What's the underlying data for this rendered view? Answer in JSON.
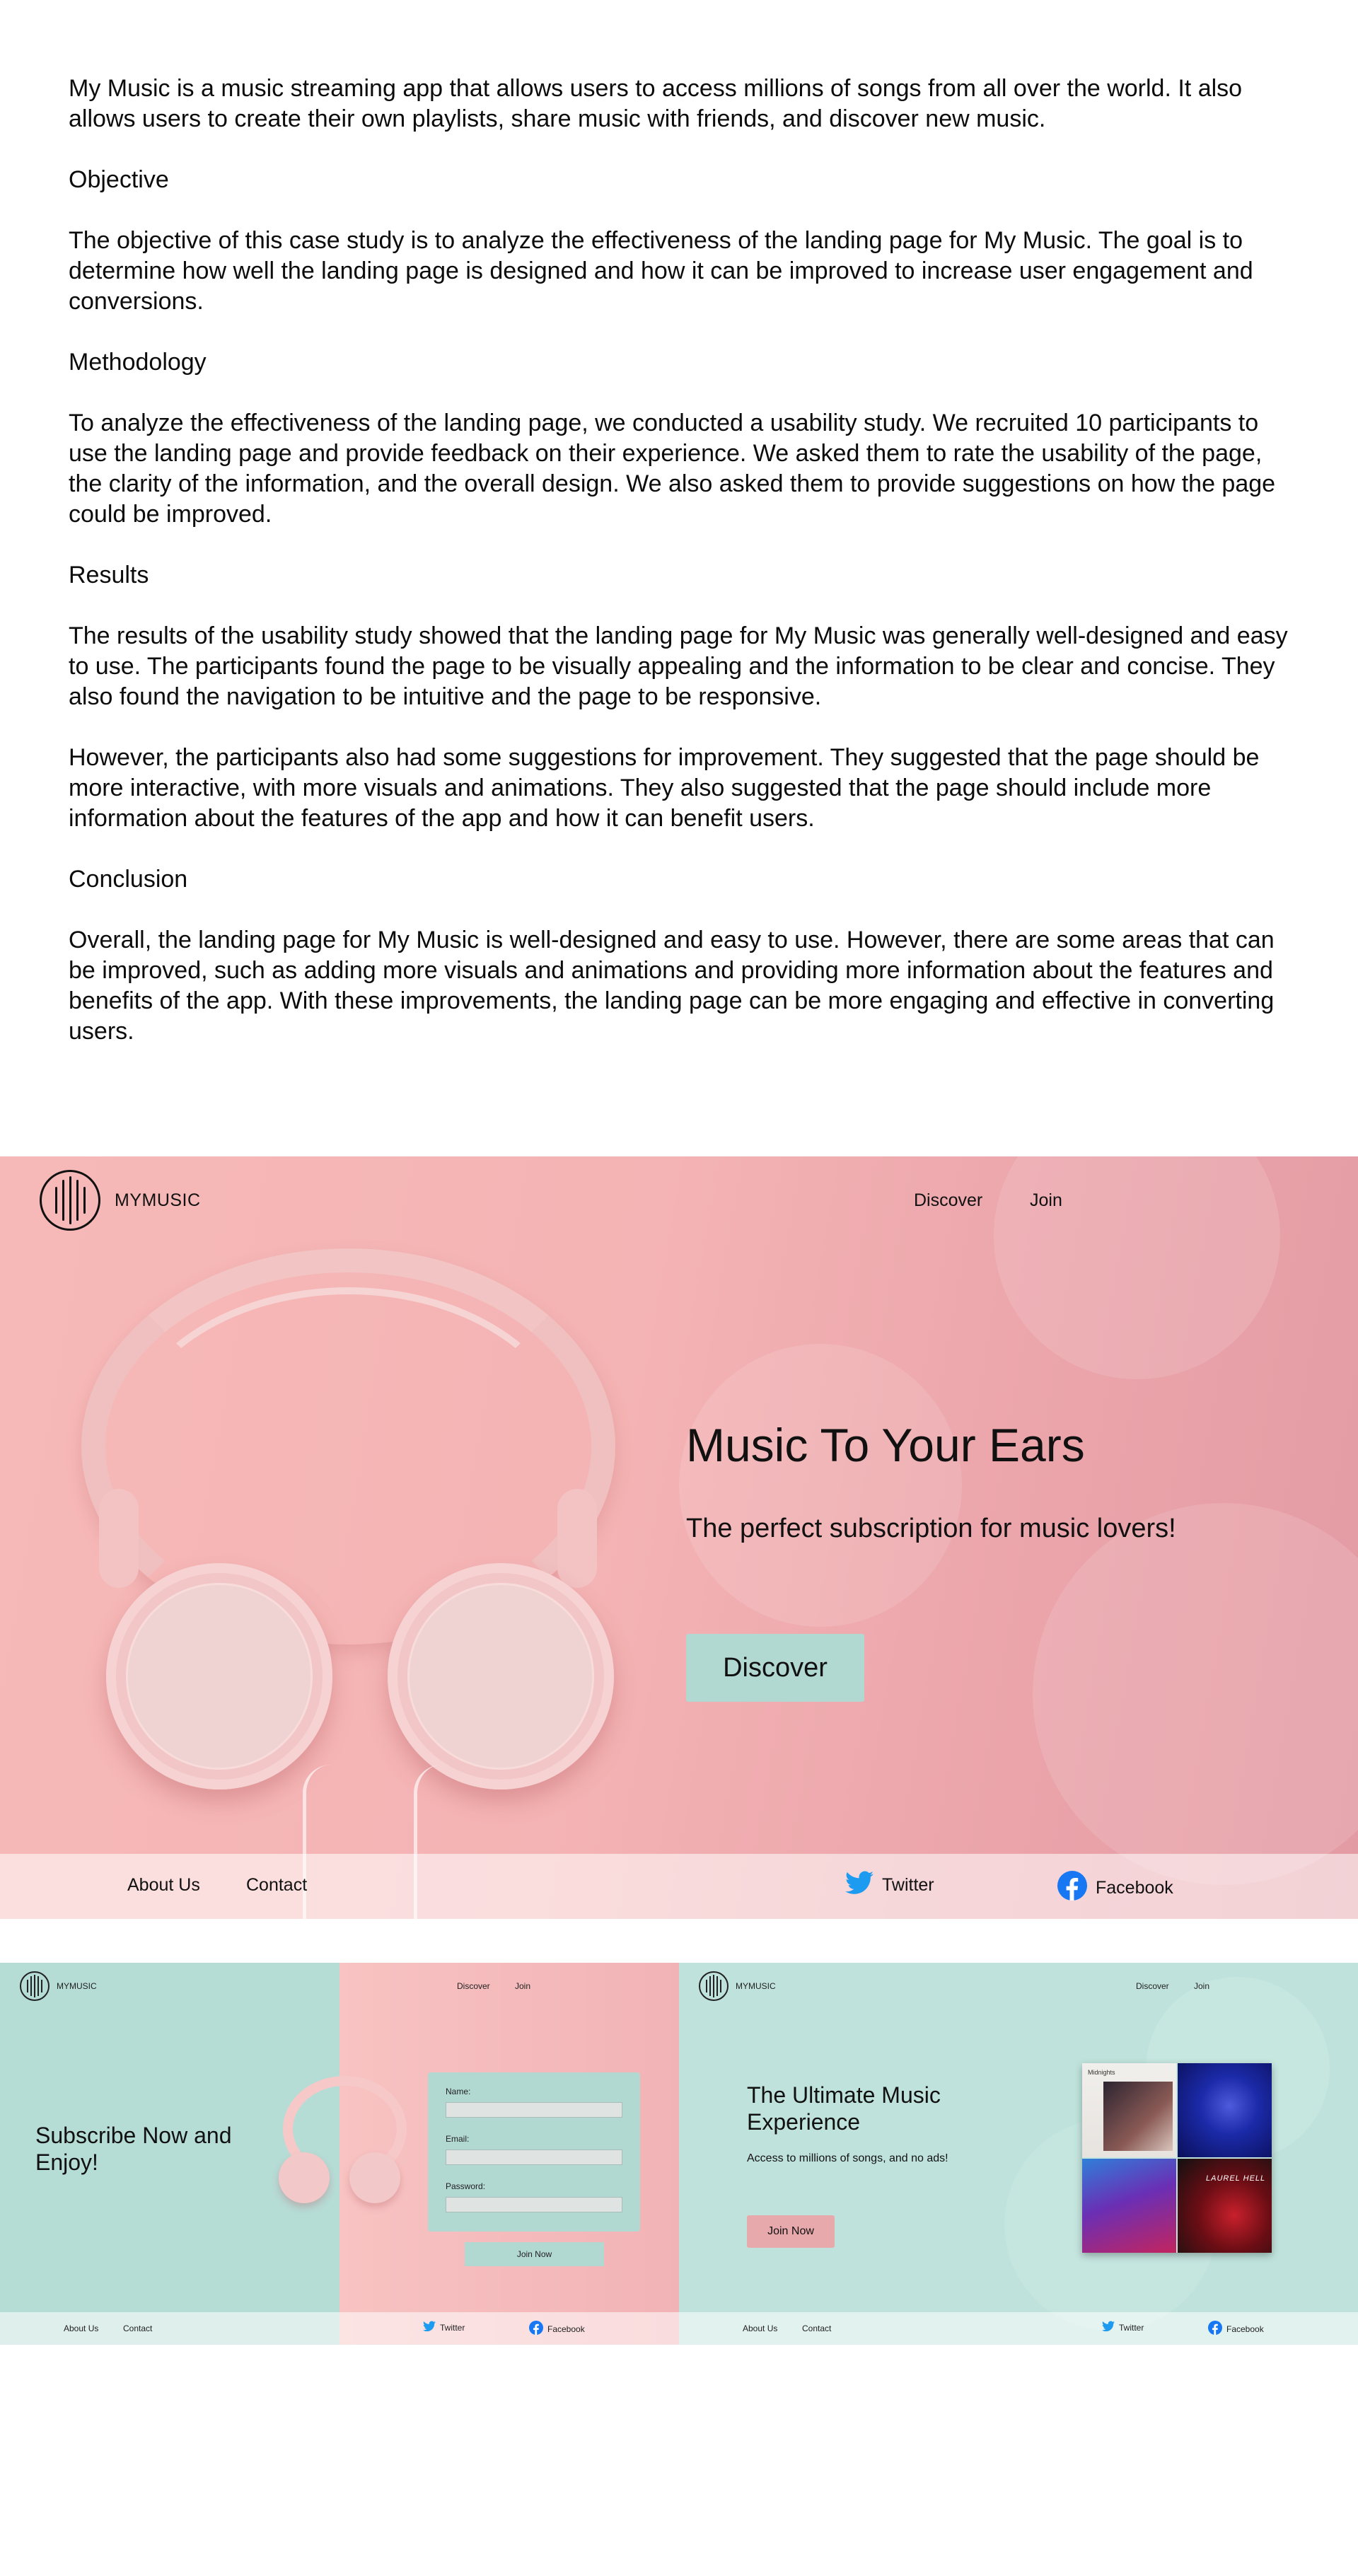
{
  "case_study": {
    "intro": "My Music is a music streaming app that allows users to access millions of songs from all over the world. It also allows users to create their own playlists, share music with friends, and discover new music.",
    "objective_heading": "Objective",
    "objective": "The objective of this case study is to analyze the effectiveness of the landing page for My Music. The goal is to determine how well the landing page is designed and how it can be improved to increase user engagement and conversions.",
    "methodology_heading": "Methodology",
    "methodology": "To analyze the effectiveness of the landing page, we conducted a usability study. We recruited 10 participants to use the landing page and provide feedback on their experience. We asked them to rate the usability of the page, the clarity of the information, and the overall design. We also asked them to provide suggestions on how the page could be improved.",
    "results_heading": "Results",
    "results": "The results of the usability study showed that the landing page for My Music was generally well-designed and easy to use. The participants found the page to be visually appealing and the information to be clear and concise. They also found the navigation to be intuitive and the page to be responsive.",
    "suggestions": "However, the participants also had some suggestions for improvement. They suggested that the page should be more interactive, with more visuals and animations. They also suggested that the page should include more information about the features of the app and how it can benefit users.",
    "conclusion_heading": "Conclusion",
    "conclusion": "Overall, the landing page for My Music is well-designed and easy to use. However, there are some areas that can be improved, such as adding more visuals and animations and providing more information about the features and benefits of the app. With these improvements, the landing page can be more engaging and effective in converting users."
  },
  "hero": {
    "brand": "MYMUSIC",
    "nav": {
      "discover": "Discover",
      "join": "Join"
    },
    "title": "Music To Your Ears",
    "subtitle": "The perfect subscription for music lovers!",
    "cta": "Discover",
    "footer": {
      "about": "About Us",
      "contact": "Contact",
      "twitter": "Twitter",
      "facebook": "Facebook"
    }
  },
  "subscribe": {
    "brand": "MYMUSIC",
    "nav": {
      "discover": "Discover",
      "join": "Join"
    },
    "heading": "Subscribe Now and Enjoy!",
    "form": {
      "name": "Name:",
      "email": "Email:",
      "password": "Password:"
    },
    "cta": "Join Now",
    "footer": {
      "about": "About Us",
      "contact": "Contact",
      "twitter": "Twitter",
      "facebook": "Facebook"
    }
  },
  "experience": {
    "brand": "MYMUSIC",
    "nav": {
      "discover": "Discover",
      "join": "Join"
    },
    "heading": "The Ultimate Music Experience",
    "subtitle": "Access to millions of songs, and no ads!",
    "cta": "Join Now",
    "album_text": {
      "midnights": "Midnights",
      "laurel": "LAUREL HELL"
    },
    "footer": {
      "about": "About Us",
      "contact": "Contact",
      "twitter": "Twitter",
      "facebook": "Facebook"
    }
  },
  "colors": {
    "pink": "#f4b3b4",
    "teal": "#b2d8d2",
    "twitter": "#1d9bf0",
    "facebook": "#1877f2"
  }
}
